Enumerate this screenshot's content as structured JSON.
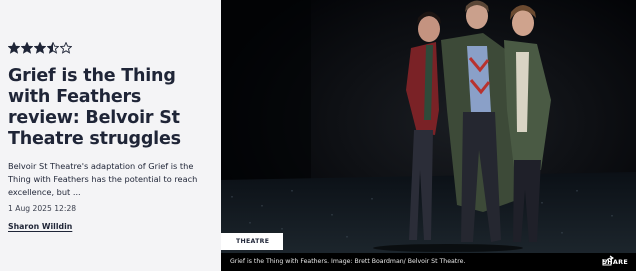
{
  "article": {
    "rating": 3.5,
    "rating_max": 5,
    "headline": "Grief is the Thing with Feathers review: Belvoir St Theatre struggles",
    "standfirst": "Belvoir St Theatre's adaptation of Grief is the Thing with Feathers has the potential to reach excellence, but ...",
    "date": "1 Aug 2025 12:28",
    "author": "Sharon Willdin"
  },
  "image": {
    "category_tag": "THEATRE",
    "caption": "Grief is the Thing with Feathers. Image: Brett Boardman/ Belvoir St Theatre.",
    "share_label": "SHARE"
  },
  "icons": {
    "star": "star-icon",
    "share": "share-icon"
  },
  "colors": {
    "star": "#1f2537",
    "headline": "#1f2537",
    "panel_background": "#f4f4f6"
  }
}
